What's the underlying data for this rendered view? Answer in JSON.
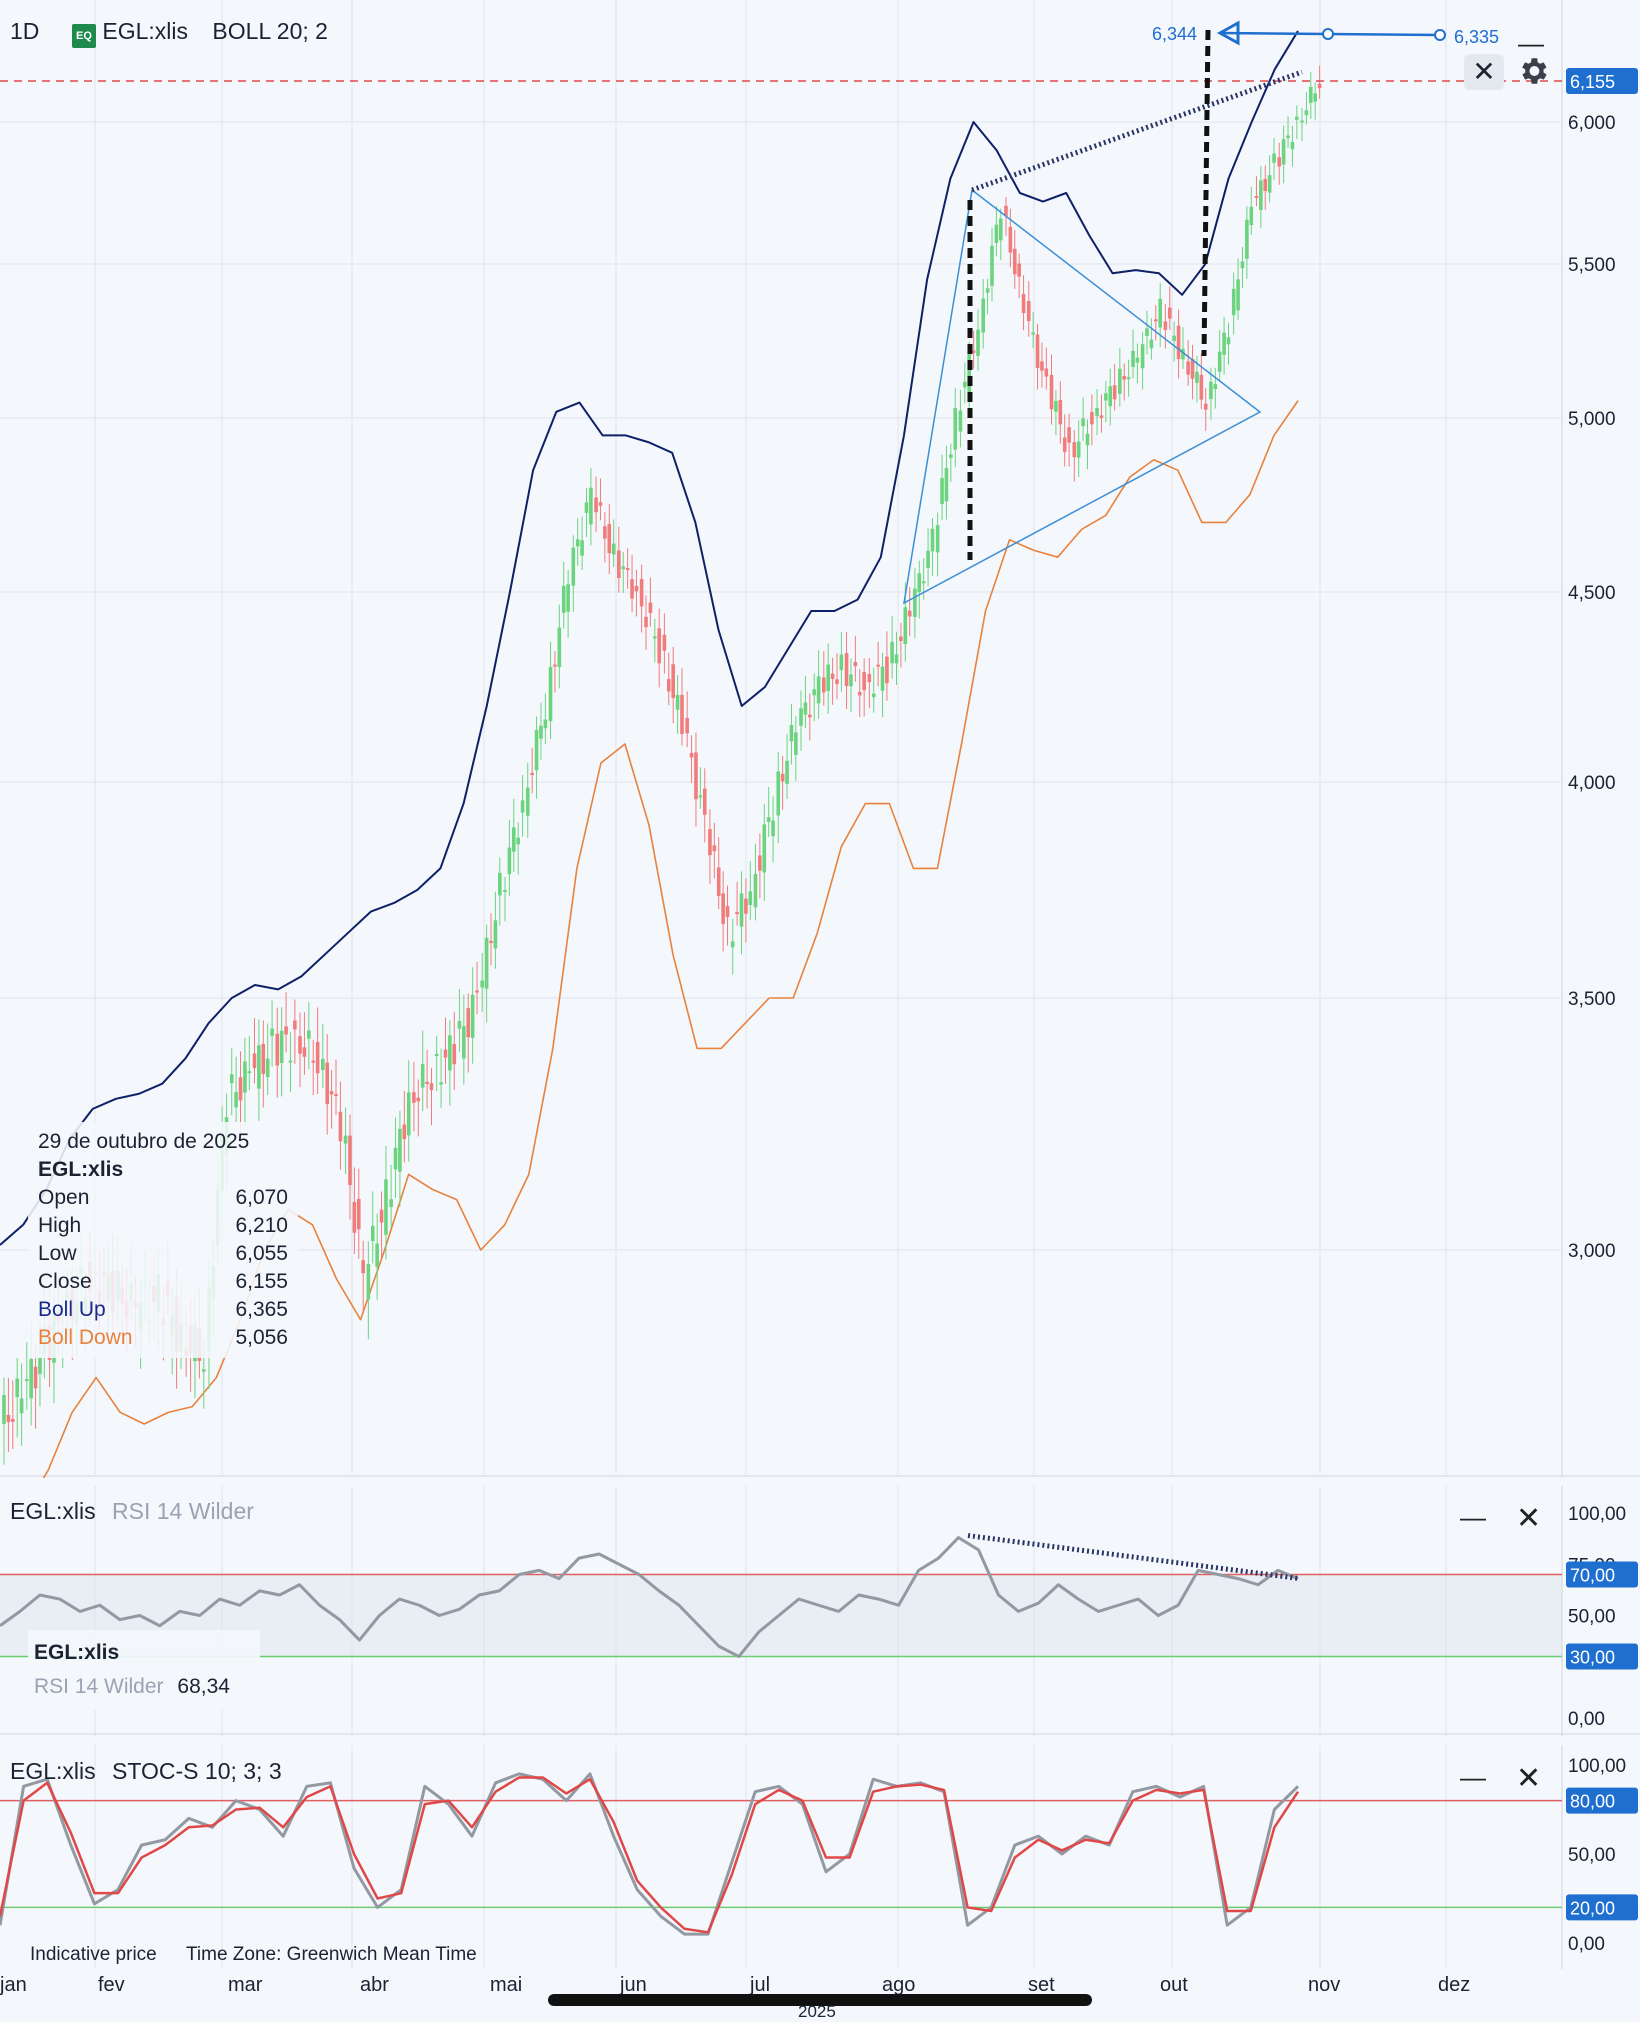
{
  "header": {
    "interval": "1D",
    "badge": "EQ",
    "symbol": "EGL:xlis",
    "indicator": "BOLL 20; 2"
  },
  "colors": {
    "background": "#f4f7fc",
    "up": "#6cd47e",
    "down": "#f07c7c",
    "boll_up": "#0e2168",
    "boll_down": "#e8823d",
    "drawing_blue": "#3c8fd6",
    "drawing_dark": "#2a3566",
    "rsi_line": "#9299a3",
    "stoch_k": "#9299a3",
    "stoch_d": "#e04848",
    "level_red": "#e06060",
    "level_green": "#6ccc70",
    "label_blue": "#1f6fd1"
  },
  "controls": {
    "close_icon": "close-icon",
    "minimize_icon": "minimize-icon",
    "settings_icon": "gear-icon"
  },
  "chart_data": [
    {
      "type": "candlestick",
      "title": "EGL:xlis BOLL 20; 2",
      "y_ticks": [
        "6,000",
        "5,500",
        "5,000",
        "4,500",
        "4,000",
        "3,500",
        "3,000"
      ],
      "y_tick_values": [
        6.0,
        5.5,
        5.0,
        4.5,
        4.0,
        3.5,
        3.0
      ],
      "x_ticks": [
        "jan",
        "fev",
        "mar",
        "abr",
        "mai",
        "jun",
        "jul",
        "ago",
        "set",
        "out",
        "nov",
        "dez"
      ],
      "year_label": "2025",
      "last_price_label": "6,155",
      "last_price": 6.155,
      "price_line_style": "red dashed",
      "drawing_labels": {
        "arrow_left": "6,344",
        "arrow_right": "6,335"
      },
      "candles": {
        "months": [
          "jan",
          "fev",
          "mar",
          "abr",
          "mai",
          "jun",
          "jul",
          "ago",
          "set",
          "out"
        ],
        "close_by_week": [
          2.75,
          2.83,
          2.9,
          2.95,
          2.93,
          2.9,
          2.92,
          2.85,
          2.82,
          3.3,
          3.35,
          3.4,
          3.42,
          3.38,
          3.25,
          2.95,
          3.1,
          3.3,
          3.35,
          3.4,
          3.5,
          3.75,
          3.95,
          4.2,
          4.55,
          4.78,
          4.6,
          4.5,
          4.35,
          4.15,
          3.9,
          3.65,
          3.75,
          3.95,
          4.15,
          4.25,
          4.3,
          4.25,
          4.3,
          4.45,
          4.65,
          5.0,
          5.3,
          5.7,
          5.35,
          5.1,
          4.9,
          5.0,
          5.1,
          5.2,
          5.35,
          5.2,
          5.05,
          5.3,
          5.7,
          5.85,
          6.0,
          6.155
        ]
      },
      "boll_up": [
        3.01,
        3.05,
        3.12,
        3.22,
        3.28,
        3.3,
        3.31,
        3.33,
        3.38,
        3.45,
        3.5,
        3.53,
        3.52,
        3.55,
        3.6,
        3.65,
        3.7,
        3.72,
        3.75,
        3.8,
        3.95,
        4.2,
        4.5,
        4.85,
        5.02,
        5.05,
        4.95,
        4.95,
        4.93,
        4.9,
        4.7,
        4.4,
        4.2,
        4.25,
        4.35,
        4.45,
        4.45,
        4.48,
        4.6,
        4.95,
        5.45,
        5.8,
        6.0,
        5.9,
        5.75,
        5.72,
        5.75,
        5.6,
        5.47,
        5.48,
        5.47,
        5.4,
        5.5,
        5.8,
        6.0,
        6.2,
        6.345
      ],
      "boll_down": [
        2.55,
        2.55,
        2.62,
        2.72,
        2.78,
        2.72,
        2.7,
        2.72,
        2.73,
        2.78,
        2.88,
        3.0,
        3.08,
        3.05,
        2.95,
        2.88,
        3.0,
        3.15,
        3.12,
        3.1,
        3.0,
        3.05,
        3.15,
        3.4,
        3.8,
        4.05,
        4.1,
        3.9,
        3.6,
        3.4,
        3.4,
        3.45,
        3.5,
        3.5,
        3.65,
        3.85,
        3.95,
        3.95,
        3.8,
        3.8,
        4.1,
        4.45,
        4.65,
        4.62,
        4.6,
        4.68,
        4.72,
        4.83,
        4.88,
        4.85,
        4.7,
        4.7,
        4.78,
        4.95,
        5.056
      ],
      "tooltip": {
        "date": "29 de outubro de 2025",
        "symbol": "EGL:xlis",
        "rows": [
          {
            "label": "Open",
            "value": "6,070"
          },
          {
            "label": "High",
            "value": "6,210"
          },
          {
            "label": "Low",
            "value": "6,055"
          },
          {
            "label": "Close",
            "value": "6,155"
          },
          {
            "label": "Boll Up",
            "value": "6,365"
          },
          {
            "label": "Boll Down",
            "value": "5,056"
          }
        ]
      }
    },
    {
      "type": "line",
      "title": "EGL:xlis RSI 14 Wilder",
      "symbol": "EGL:xlis",
      "indicator": "RSI 14 Wilder",
      "y_ticks": [
        "100,00",
        "75,00",
        "50,00",
        "0,00"
      ],
      "levels": [
        {
          "value": 70,
          "label": "70,00",
          "color": "red"
        },
        {
          "value": 30,
          "label": "30,00",
          "color": "green"
        }
      ],
      "last_value_label": "68,34",
      "values": [
        45,
        52,
        60,
        58,
        52,
        55,
        48,
        50,
        45,
        52,
        50,
        58,
        55,
        62,
        60,
        65,
        55,
        48,
        38,
        50,
        58,
        55,
        50,
        53,
        60,
        62,
        70,
        72,
        68,
        78,
        80,
        75,
        70,
        62,
        55,
        45,
        35,
        30,
        42,
        50,
        58,
        55,
        52,
        60,
        58,
        55,
        72,
        78,
        88,
        82,
        60,
        52,
        56,
        65,
        58,
        52,
        55,
        58,
        50,
        55,
        72,
        70,
        68,
        65,
        72,
        68
      ]
    },
    {
      "type": "line",
      "title": "EGL:xlis STOC-S 10; 3; 3",
      "symbol": "EGL:xlis",
      "indicator": "STOC-S 10; 3; 3",
      "y_ticks": [
        "100,00",
        "50,00",
        "0,00"
      ],
      "levels": [
        {
          "value": 80,
          "label": "80,00",
          "color": "red"
        },
        {
          "value": 20,
          "label": "20,00",
          "color": "green"
        }
      ],
      "series": [
        {
          "name": "%K",
          "values": [
            10,
            88,
            92,
            55,
            22,
            30,
            55,
            58,
            70,
            65,
            80,
            75,
            60,
            88,
            90,
            42,
            20,
            30,
            88,
            78,
            60,
            90,
            95,
            92,
            80,
            95,
            60,
            30,
            15,
            5,
            5,
            45,
            85,
            88,
            78,
            40,
            50,
            92,
            88,
            90,
            85,
            10,
            20,
            55,
            60,
            50,
            60,
            55,
            85,
            88,
            82,
            88,
            10,
            20,
            75,
            88
          ]
        },
        {
          "name": "%D",
          "values": [
            15,
            80,
            90,
            62,
            28,
            28,
            48,
            55,
            65,
            66,
            75,
            76,
            65,
            82,
            88,
            50,
            25,
            28,
            78,
            80,
            65,
            85,
            93,
            93,
            84,
            92,
            68,
            35,
            20,
            8,
            6,
            38,
            78,
            86,
            80,
            48,
            48,
            85,
            88,
            89,
            86,
            20,
            18,
            48,
            58,
            52,
            58,
            56,
            80,
            86,
            84,
            86,
            18,
            18,
            65,
            85
          ]
        }
      ]
    }
  ],
  "rsi_legend": {
    "symbol": "EGL:xlis",
    "indicator": "RSI 14 Wilder",
    "value": "68,34"
  },
  "footer": {
    "indicative": "Indicative price",
    "timezone": "Time Zone: Greenwich Mean Time"
  }
}
